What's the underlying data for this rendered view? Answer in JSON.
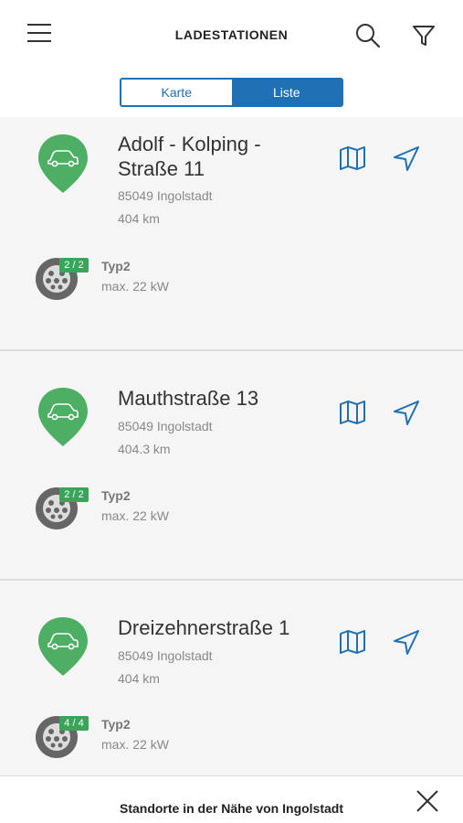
{
  "header": {
    "title": "LADESTATIONEN"
  },
  "segment": {
    "map_label": "Karte",
    "list_label": "Liste",
    "selected": "Liste"
  },
  "accent_color": "#1f6fb5",
  "status_color": "#3aa55a",
  "stations": [
    {
      "street_line1": "Adolf - Kolping -",
      "street_line2": "Straße 11",
      "city": "85049 Ingolstadt",
      "distance": "404 km",
      "availability": "2 / 2",
      "connector_type": "Typ2",
      "power": "max. 22 kW"
    },
    {
      "street_line1": "Mauthstraße 13",
      "street_line2": "",
      "city": "85049 Ingolstadt",
      "distance": "404.3 km",
      "availability": "2 / 2",
      "connector_type": "Typ2",
      "power": "max. 22 kW"
    },
    {
      "street_line1": "Dreizehnerstraße 1",
      "street_line2": "",
      "city": "85049 Ingolstadt",
      "distance": "404 km",
      "availability": "4 / 4",
      "connector_type": "Typ2",
      "power": "max. 22 kW"
    }
  ],
  "footer": {
    "text": "Standorte in der Nähe von Ingolstadt"
  },
  "icons": [
    "menu-icon",
    "search-icon",
    "filter-icon",
    "map-icon",
    "navigate-icon",
    "car-pin-icon",
    "plug-icon",
    "close-icon"
  ]
}
